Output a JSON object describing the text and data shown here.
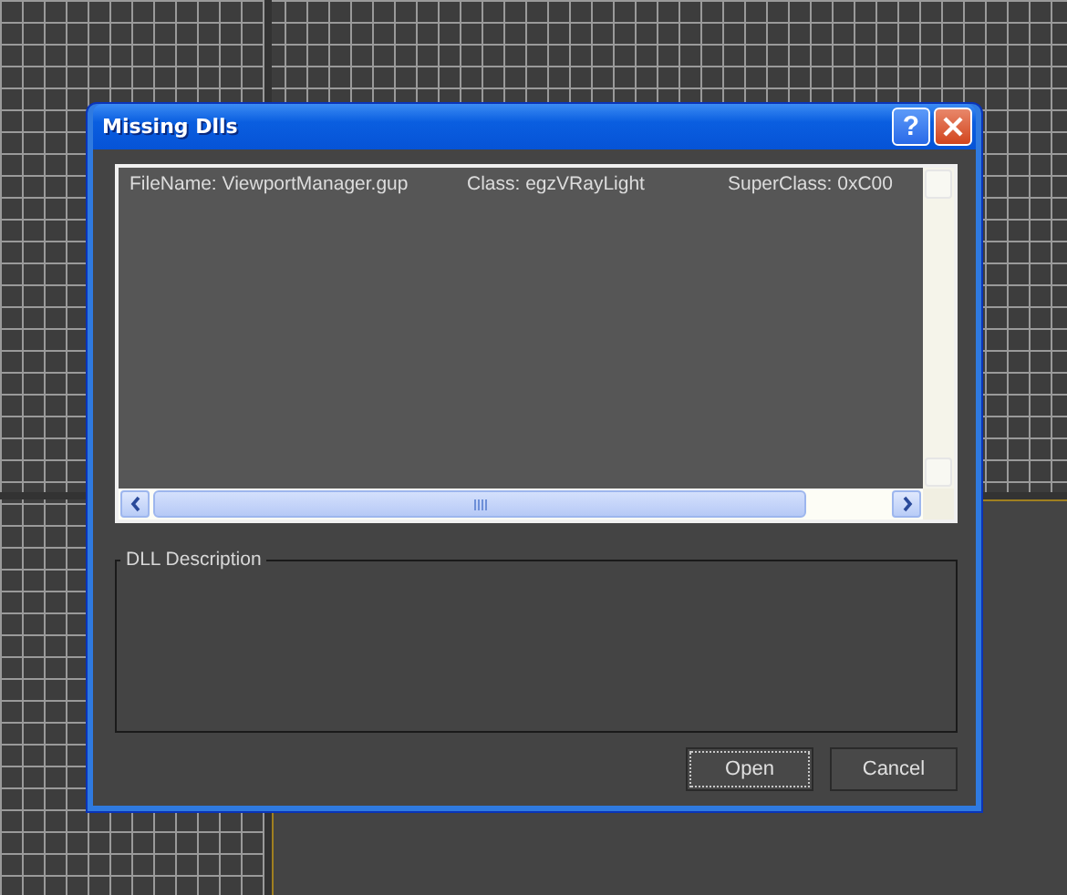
{
  "window": {
    "title": "Missing Dlls",
    "help_button": "?"
  },
  "list": {
    "rows": [
      {
        "cells": [
          "FileName:  ViewportManager.gup",
          "Class: egzVRayLight",
          "SuperClass: 0xC00"
        ]
      }
    ]
  },
  "description_group": {
    "label": "DLL Description"
  },
  "buttons": [
    {
      "label": "Open",
      "focused": true
    },
    {
      "label": "Cancel",
      "focused": false
    }
  ]
}
